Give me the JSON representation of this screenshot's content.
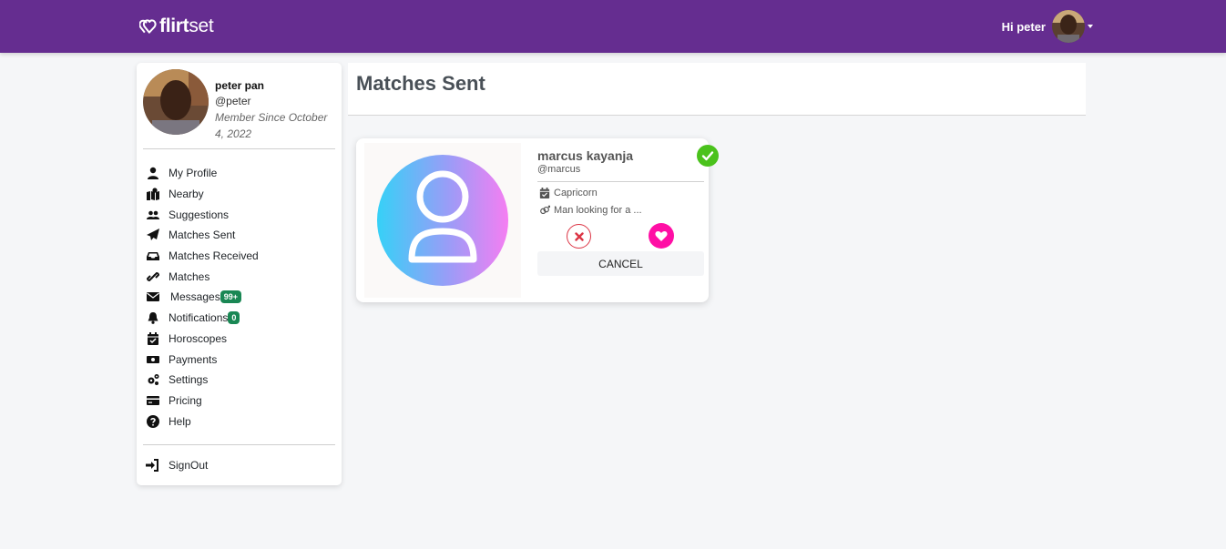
{
  "header": {
    "brand_bold": "flirt",
    "brand_light": "set",
    "greeting": "Hi peter",
    "colors": {
      "bar": "#652d90"
    }
  },
  "profile": {
    "name": "peter pan",
    "handle": "@peter",
    "member_since": "Member Since October 4, 2022"
  },
  "menu": [
    {
      "label": "My Profile",
      "icon": "user-icon"
    },
    {
      "label": "Nearby",
      "icon": "map-marker-icon"
    },
    {
      "label": "Suggestions",
      "icon": "users-icon"
    },
    {
      "label": "Matches Sent",
      "icon": "paper-plane-icon"
    },
    {
      "label": "Matches Received",
      "icon": "inbox-icon"
    },
    {
      "label": "Matches",
      "icon": "link-icon"
    },
    {
      "label": "Messages",
      "icon": "envelope-icon",
      "badge": "99+"
    },
    {
      "label": "Notifications",
      "icon": "bell-icon",
      "badge": "0"
    },
    {
      "label": "Horoscopes",
      "icon": "calendar-check-icon"
    },
    {
      "label": "Payments",
      "icon": "money-bill-icon"
    },
    {
      "label": "Settings",
      "icon": "cogs-icon"
    },
    {
      "label": "Pricing",
      "icon": "credit-card-icon"
    },
    {
      "label": "Help",
      "icon": "question-circle-icon"
    }
  ],
  "signout": {
    "label": "SignOut",
    "icon": "sign-in-icon"
  },
  "page": {
    "title": "Matches Sent"
  },
  "match_card": {
    "name": "marcus kayanja",
    "handle": "@marcus",
    "zodiac": "Capricorn",
    "looking_for": "Man looking for a ...",
    "cancel_label": "CANCEL",
    "status_icon": "check-circle-icon",
    "colors": {
      "check": "#4ac21c",
      "like": "#ff0fa5",
      "reject": "#dc3545"
    }
  }
}
